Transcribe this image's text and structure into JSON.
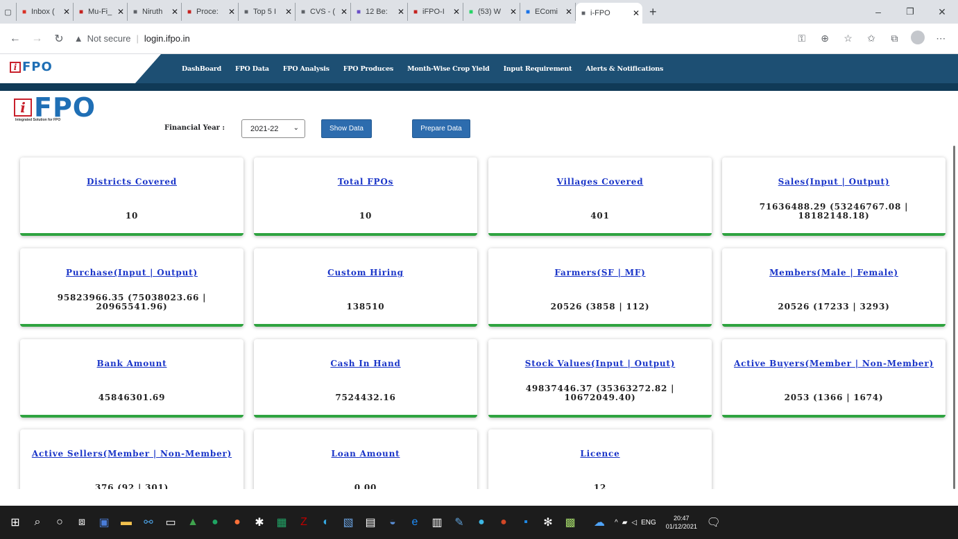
{
  "browser": {
    "tabs": [
      {
        "label": "Inbox (",
        "icon": "gmail-icon",
        "color": "#d93025"
      },
      {
        "label": "Mu-Fi_",
        "icon": "form-icon",
        "color": "#c5221f"
      },
      {
        "label": "Niruth",
        "icon": "page-icon",
        "color": "#5f6368"
      },
      {
        "label": "Proce:",
        "icon": "form-icon",
        "color": "#c5221f"
      },
      {
        "label": "Top 5 I",
        "icon": "image-icon",
        "color": "#5f6368"
      },
      {
        "label": "CVS - (",
        "icon": "page-icon",
        "color": "#5f6368"
      },
      {
        "label": "12 Be:",
        "icon": "k-icon",
        "color": "#6a4fc7"
      },
      {
        "label": "iFPO-I",
        "icon": "form-icon",
        "color": "#c5221f"
      },
      {
        "label": "(53) W",
        "icon": "whatsapp-icon",
        "color": "#25d366"
      },
      {
        "label": "EComi",
        "icon": "b-icon",
        "color": "#1a73e8"
      },
      {
        "label": "i-FPO",
        "icon": "page-icon",
        "color": "#5f6368",
        "active": true
      }
    ],
    "security_label": "Not secure",
    "url": "login.ifpo.in"
  },
  "site": {
    "logo_i": "i",
    "logo_text": "FPO",
    "logo_tagline": "Integrated Solution for FPO",
    "nav": [
      "DashBoard",
      "FPO Data",
      "FPO Analysis",
      "FPO Produces",
      "Month-Wise Crop Yield",
      "Input Requirement",
      "Alerts & Notifications"
    ]
  },
  "filter": {
    "label": "Financial Year :",
    "selected_year": "2021-22",
    "show_button": "Show Data",
    "prepare_button": "Prepare Data"
  },
  "cards": [
    {
      "title": "Districts Covered",
      "value": "10"
    },
    {
      "title": "Total FPOs",
      "value": "10"
    },
    {
      "title": "Villages Covered",
      "value": "401"
    },
    {
      "title": "Sales(Input | Output)",
      "value": "71636488.29 (53246767.08 | 18182148.18)"
    },
    {
      "title": "Purchase(Input | Output)",
      "value": "95823966.35 (75038023.66 | 20965541.96)"
    },
    {
      "title": "Custom Hiring",
      "value": "138510"
    },
    {
      "title": "Farmers(SF | MF)",
      "value": "20526 (3858 | 112)"
    },
    {
      "title": "Members(Male | Female)",
      "value": "20526 (17233 | 3293)"
    },
    {
      "title": "Bank Amount",
      "value": "45846301.69"
    },
    {
      "title": "Cash In Hand",
      "value": "7524432.16"
    },
    {
      "title": "Stock Values(Input | Output)",
      "value": "49837446.37 (35363272.82 | 10672049.40)"
    },
    {
      "title": "Active Buyers(Member | Non-Member)",
      "value": "2053 (1366 | 1674)"
    },
    {
      "title": "Active Sellers(Member | Non-Member)",
      "value": "376 (92 | 301)"
    },
    {
      "title": "Loan Amount",
      "value": "0.00"
    },
    {
      "title": "Licence",
      "value": "12"
    }
  ],
  "taskbar": {
    "lang": "ENG",
    "time": "20:47",
    "date": "01/12/2021"
  },
  "colors": {
    "nav_bg": "#1d4f73",
    "card_accent": "#2fa340",
    "link": "#1a35c8",
    "button": "#2d6cae"
  }
}
